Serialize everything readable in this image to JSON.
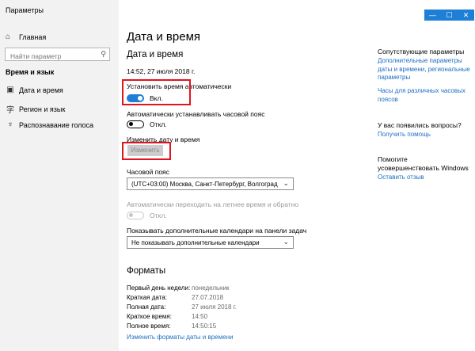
{
  "window": {
    "title": "Параметры",
    "min_glyph": "—",
    "max_glyph": "☐",
    "close_glyph": "✕"
  },
  "sidebar": {
    "home": "Главная",
    "search_placeholder": "Найти параметр",
    "section": "Время и язык",
    "items": [
      {
        "label": "Дата и время",
        "icon": "calendar-clock-icon"
      },
      {
        "label": "Регион и язык",
        "icon": "globe-language-icon"
      },
      {
        "label": "Распознавание голоса",
        "icon": "microphone-icon"
      }
    ]
  },
  "main": {
    "page_title": "Дата и время",
    "section_title": "Дата и время",
    "current_datetime": "14:52, 27 июля 2018 г.",
    "auto_time_label": "Установить время автоматически",
    "auto_time_state": "Вкл.",
    "auto_tz_label": "Автоматически устанавливать часовой пояс",
    "auto_tz_state": "Откл.",
    "change_date_label": "Изменить дату и время",
    "change_button": "Изменить",
    "timezone_label": "Часовой пояс",
    "timezone_value": "(UTC+03:00) Москва, Санкт-Петербург, Волгоград",
    "dst_label": "Автоматически переходить на летнее время и обратно",
    "dst_state": "Откл.",
    "calendars_label": "Показывать дополнительные календари на панели задач",
    "calendars_value": "Не показывать дополнительные календари",
    "formats_title": "Форматы",
    "formats": [
      {
        "key": "Первый день недели:",
        "value": "понедельник"
      },
      {
        "key": "Краткая дата:",
        "value": "27.07.2018"
      },
      {
        "key": "Полная дата:",
        "value": "27 июля 2018 г."
      },
      {
        "key": "Краткое время:",
        "value": "14:50"
      },
      {
        "key": "Полное время:",
        "value": "14:50:15"
      }
    ],
    "formats_link": "Изменить форматы даты и времени"
  },
  "right": {
    "related_title": "Сопутствующие параметры",
    "link_additional": "Дополнительные параметры даты и времени, региональные параметры",
    "link_clocks": "Часы для различных часовых поясов",
    "question_title": "У вас появились вопросы?",
    "help_link": "Получить помощь",
    "improve_text": "Помогите усовершенствовать Windows",
    "feedback_link": "Оставить отзыв"
  },
  "colors": {
    "accent": "#1e7fd6",
    "link": "#1e6fc2",
    "highlight": "#e0141e",
    "sidebar_bg": "#f2f2f2"
  }
}
